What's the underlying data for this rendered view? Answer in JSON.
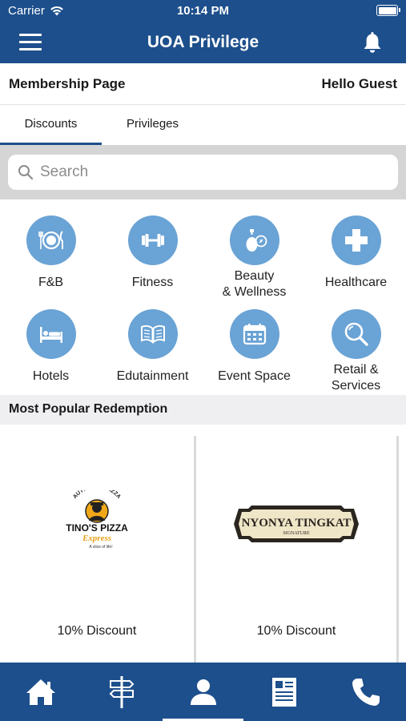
{
  "status_bar": {
    "carrier": "Carrier",
    "time": "10:14 PM",
    "battery_level": 1.0
  },
  "header": {
    "title": "UOA Privilege",
    "menu_icon": "hamburger-icon",
    "notification_icon": "bell-icon"
  },
  "membership": {
    "page_label": "Membership Page",
    "greeting": "Hello Guest"
  },
  "tabs": [
    {
      "label": "Discounts",
      "active": true
    },
    {
      "label": "Privileges",
      "active": false
    }
  ],
  "search": {
    "placeholder": "Search"
  },
  "categories": [
    {
      "label": "F&B",
      "icon": "plate-cutlery-icon"
    },
    {
      "label": "Fitness",
      "icon": "dumbbell-icon"
    },
    {
      "label_line1": "Beauty",
      "label_line2": "& Wellness",
      "icon": "cosmetics-icon"
    },
    {
      "label": "Healthcare",
      "icon": "medical-cross-icon"
    },
    {
      "label": "Hotels",
      "icon": "bed-icon"
    },
    {
      "label": "Edutainment",
      "icon": "book-icon"
    },
    {
      "label": "Event Space",
      "icon": "calendar-icon"
    },
    {
      "label_line1": "Retail &",
      "label_line2": "Services",
      "icon": "magnifier-icon"
    }
  ],
  "popular": {
    "heading": "Most Popular Redemption",
    "items": [
      {
        "logo_top": "AUTHENTIC PIZZA",
        "logo_main": "TINO'S PIZZA",
        "logo_sub": "Express",
        "logo_tag": "A slice of life!",
        "discount": "10% Discount"
      },
      {
        "logo_main": "NYONYA TINGKAT",
        "logo_sub": "SIGNATURE",
        "discount": "10% Discount"
      }
    ]
  },
  "tab_bar": [
    {
      "icon": "home-icon",
      "active": false
    },
    {
      "icon": "signpost-icon",
      "active": false
    },
    {
      "icon": "profile-icon",
      "active": true
    },
    {
      "icon": "document-icon",
      "active": false
    },
    {
      "icon": "phone-icon",
      "active": false
    }
  ],
  "colors": {
    "brand_blue": "#1d4f8c",
    "icon_circle": "#6aa3d5",
    "search_band": "#d5d5d5",
    "section_band": "#efeff2"
  }
}
